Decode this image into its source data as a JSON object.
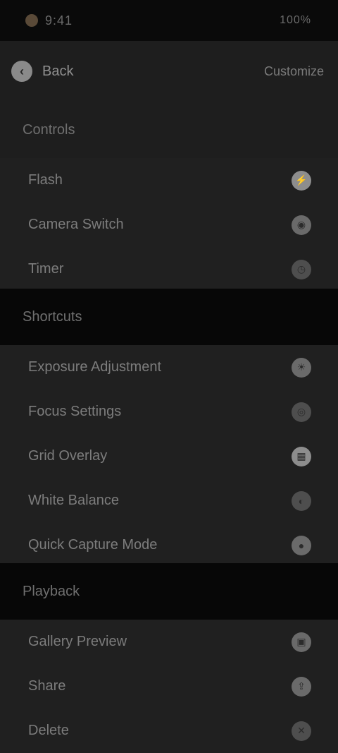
{
  "status_bar": {
    "time": "9:41",
    "right": "100%"
  },
  "app_bar": {
    "back_label": "Back",
    "action_label": "Customize"
  },
  "sections": [
    {
      "header": "Controls",
      "items": [
        {
          "label": "Flash",
          "icon": "flash-icon"
        },
        {
          "label": "Camera Switch",
          "icon": "camera-icon"
        },
        {
          "label": "Timer",
          "icon": "timer-icon"
        }
      ]
    },
    {
      "header": "Shortcuts",
      "items": [
        {
          "label": "Exposure Adjustment",
          "icon": "exposure-icon"
        },
        {
          "label": "Focus Settings",
          "icon": "focus-icon"
        },
        {
          "label": "Grid Overlay",
          "icon": "grid-icon"
        },
        {
          "label": "White Balance",
          "icon": "balance-icon"
        },
        {
          "label": "Quick Capture Mode",
          "icon": "capture-icon"
        }
      ]
    },
    {
      "header": "Playback",
      "items": [
        {
          "label": "Gallery Preview",
          "icon": "gallery-icon"
        },
        {
          "label": "Share",
          "icon": "share-icon"
        },
        {
          "label": "Delete",
          "icon": "delete-icon"
        }
      ]
    }
  ]
}
